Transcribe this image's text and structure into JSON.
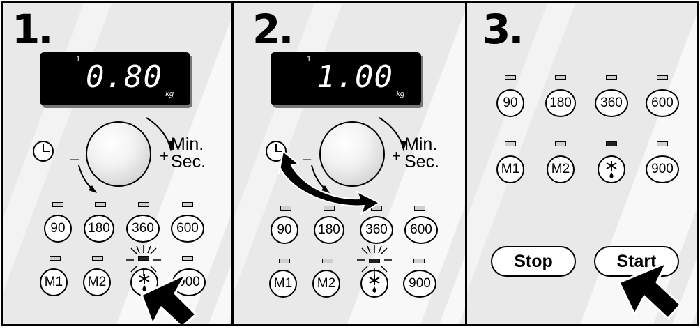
{
  "panels": [
    {
      "step": "1.",
      "display": {
        "program": "1",
        "value": "0.80",
        "unit": "kg"
      }
    },
    {
      "step": "2.",
      "display": {
        "program": "1",
        "value": "1.00",
        "unit": "kg"
      }
    },
    {
      "step": "3."
    }
  ],
  "dial": {
    "minus": "–",
    "plus": "+",
    "min_label": "Min.",
    "sec_label": "Sec."
  },
  "buttons": {
    "p90": "90",
    "p180": "180",
    "p360": "360",
    "p600": "600",
    "m1": "M1",
    "m2": "M2",
    "p900": "900"
  },
  "controls": {
    "stop": "Stop",
    "start": "Start"
  },
  "icons": [
    "clock-icon",
    "defrost-icon",
    "pointer-hand-arrow",
    "rotate-arrow"
  ],
  "colors": {
    "panel": "#e9e9e9",
    "stripe": "#f8f8f8",
    "outline": "#000000"
  }
}
